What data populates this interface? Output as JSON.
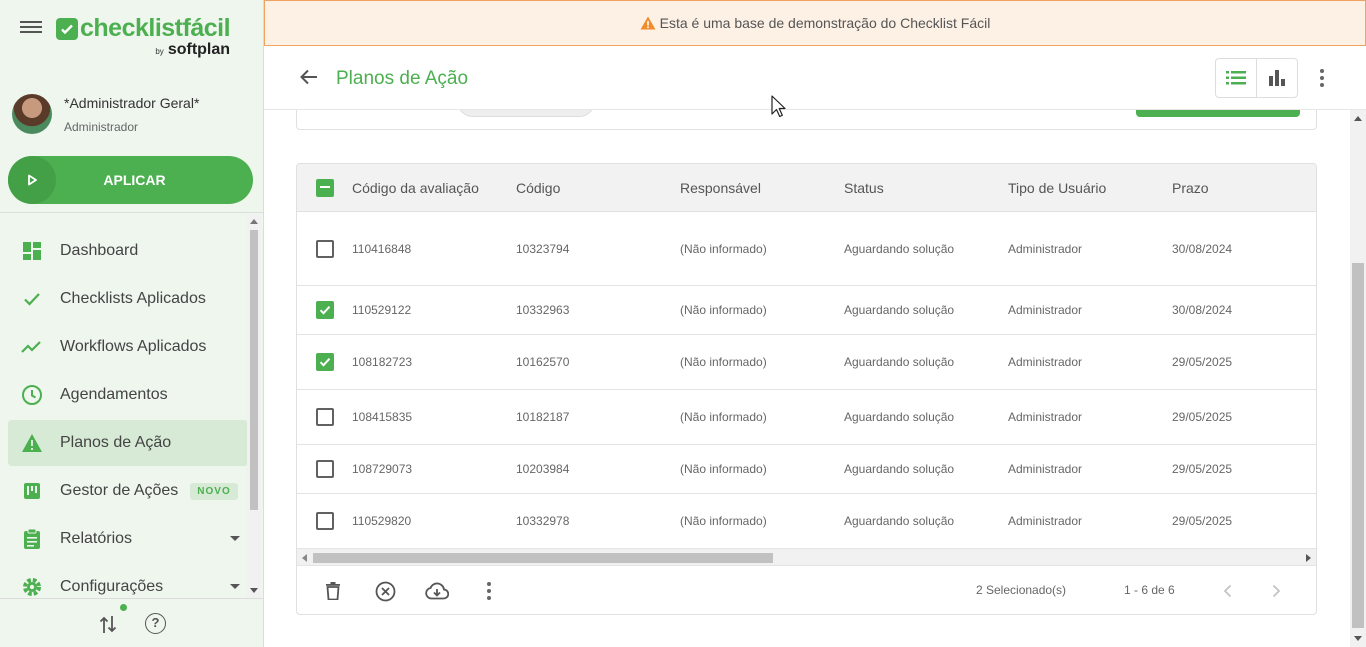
{
  "brand": {
    "name": "checklistfácil",
    "by": "by",
    "company": "softplan"
  },
  "user": {
    "name": "*Administrador Geral*",
    "role": "Administrador"
  },
  "apply_button": "APLICAR",
  "nav": [
    {
      "label": "Dashboard",
      "icon": "dashboard-icon"
    },
    {
      "label": "Checklists Aplicados",
      "icon": "check-icon"
    },
    {
      "label": "Workflows Aplicados",
      "icon": "trend-icon"
    },
    {
      "label": "Agendamentos",
      "icon": "clock-icon"
    },
    {
      "label": "Planos de Ação",
      "icon": "warning-icon",
      "active": true
    },
    {
      "label": "Gestor de Ações",
      "icon": "board-icon",
      "badge": "NOVO"
    },
    {
      "label": "Relatórios",
      "icon": "clipboard-icon",
      "has_submenu": true
    },
    {
      "label": "Configurações",
      "icon": "gear-icon",
      "has_submenu": true
    }
  ],
  "banner": "Esta é uma base de demonstração do Checklist Fácil",
  "page_title": "Planos de Ação",
  "table": {
    "headers": [
      "Código da avaliação",
      "Código",
      "Responsável",
      "Status",
      "Tipo de Usuário",
      "Prazo"
    ],
    "rows": [
      {
        "checked": false,
        "cells": [
          "110416848",
          "10323794",
          "(Não informado)",
          "Aguardando solução",
          "Administrador",
          "30/08/2024"
        ]
      },
      {
        "checked": true,
        "cells": [
          "110529122",
          "10332963",
          "(Não informado)",
          "Aguardando solução",
          "Administrador",
          "30/08/2024"
        ]
      },
      {
        "checked": true,
        "cells": [
          "108182723",
          "10162570",
          "(Não informado)",
          "Aguardando solução",
          "Administrador",
          "29/05/2025"
        ]
      },
      {
        "checked": false,
        "cells": [
          "108415835",
          "10182187",
          "(Não informado)",
          "Aguardando solução",
          "Administrador",
          "29/05/2025"
        ]
      },
      {
        "checked": false,
        "cells": [
          "108729073",
          "10203984",
          "(Não informado)",
          "Aguardando solução",
          "Administrador",
          "29/05/2025"
        ]
      },
      {
        "checked": false,
        "cells": [
          "110529820",
          "10332978",
          "(Não informado)",
          "Aguardando solução",
          "Administrador",
          "29/05/2025"
        ]
      }
    ]
  },
  "footer": {
    "selected": "2 Selecionado(s)",
    "range": "1 - 6 de 6"
  },
  "colors": {
    "accent": "#4caf50",
    "banner_bg": "#fdf1e6",
    "banner_border": "#f0a35e",
    "warning": "#f08c2c"
  }
}
